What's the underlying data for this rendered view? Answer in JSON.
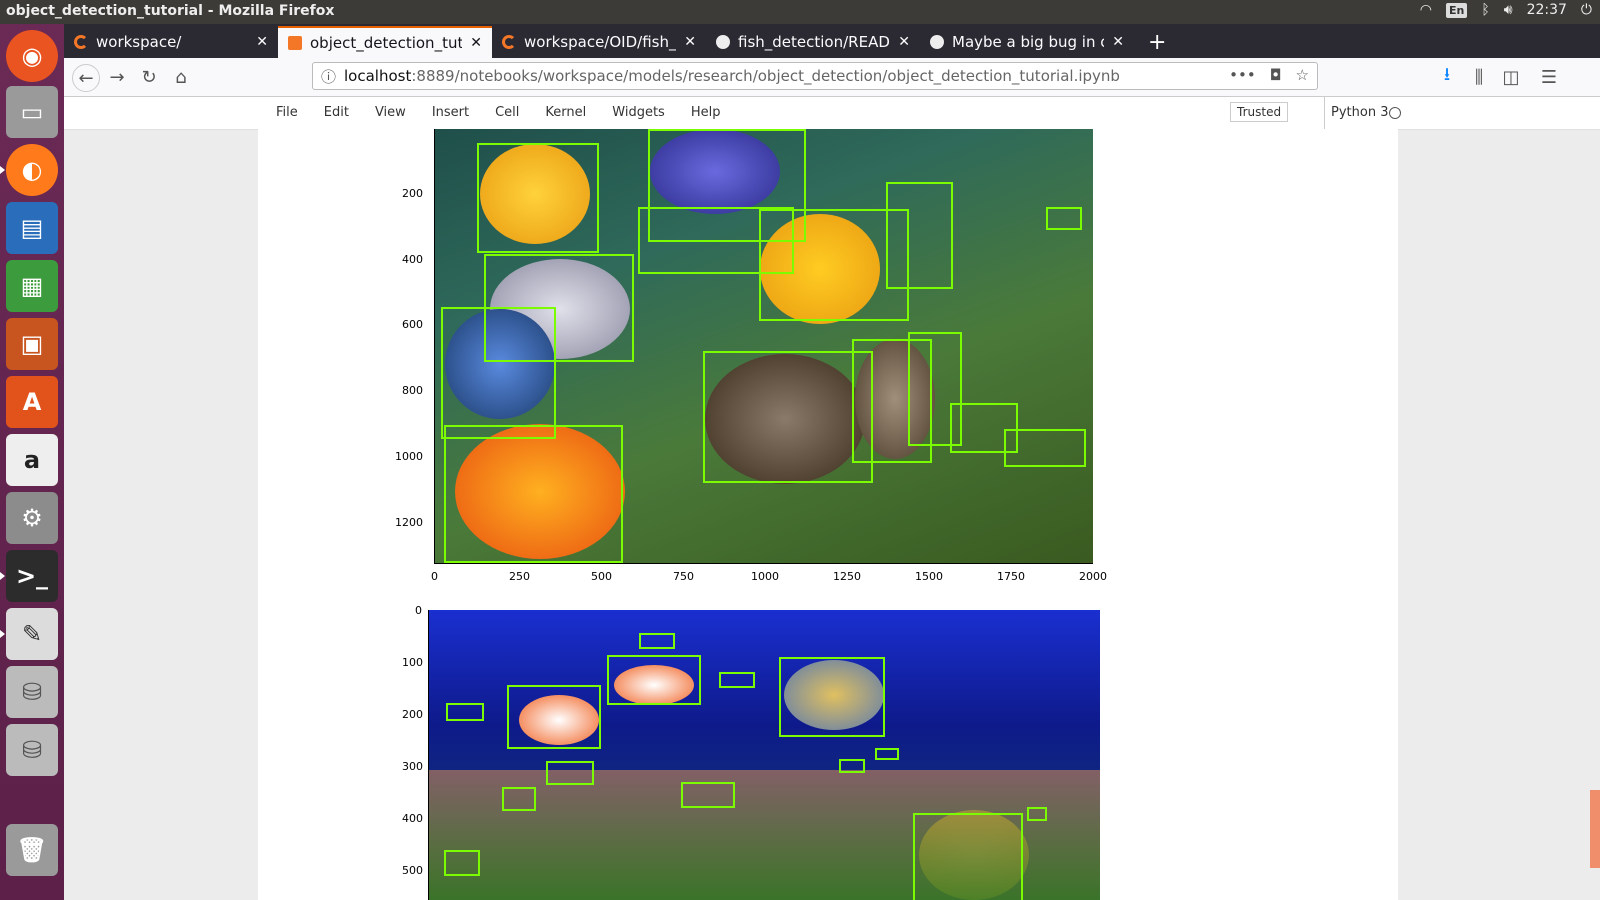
{
  "window": {
    "title": "object_detection_tutorial - Mozilla Firefox"
  },
  "tray": {
    "lang": "En",
    "time": "22:37"
  },
  "tabs": [
    {
      "label": "workspace/",
      "icon": "jupyter-icon"
    },
    {
      "label": "object_detection_tutori",
      "icon": "notebook-icon",
      "active": true
    },
    {
      "label": "workspace/OID/fish_de",
      "icon": "jupyter-icon"
    },
    {
      "label": "fish_detection/README",
      "icon": "github-icon"
    },
    {
      "label": "Maybe a big bug in obje",
      "icon": "github-icon"
    }
  ],
  "url": {
    "host": "localhost",
    "path": ":8889/notebooks/workspace/models/research/object_detection/object_detection_tutorial.ipynb"
  },
  "jupyter": {
    "menu": [
      "File",
      "Edit",
      "View",
      "Insert",
      "Cell",
      "Kernel",
      "Widgets",
      "Help"
    ],
    "trusted": "Trusted",
    "kernel": "Python 3"
  },
  "plot1": {
    "yticks": [
      "200",
      "400",
      "600",
      "800",
      "1000",
      "1200"
    ],
    "xticks": [
      "0",
      "250",
      "500",
      "750",
      "1000",
      "1250",
      "1500",
      "1750",
      "2000"
    ]
  },
  "plot2": {
    "yticks": [
      "0",
      "100",
      "200",
      "300",
      "400",
      "500"
    ]
  },
  "colors": {
    "accent": "#e66000",
    "box": "#7cfc00",
    "launcher": "#5c2049"
  }
}
